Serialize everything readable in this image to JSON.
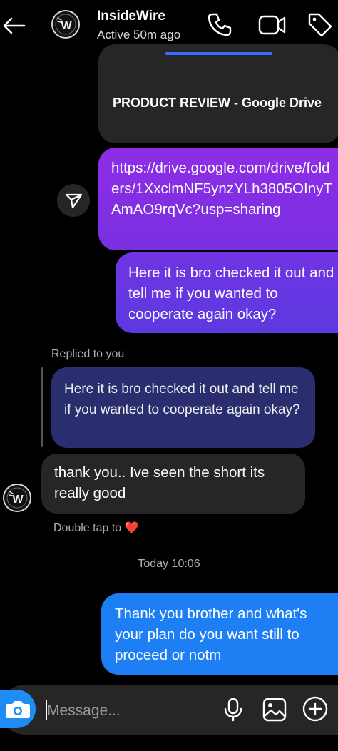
{
  "header": {
    "name": "InsideWire",
    "status": "Active 50m ago",
    "avatar_text": "W"
  },
  "shared_post": {
    "title": "PRODUCT REVIEW - Google Drive"
  },
  "messages": {
    "outgoing_link": "https://drive.google.com/drive/folders/1XxclmNF5ynzYLh3805OInyTAmAO9rqVc?usp=sharing",
    "outgoing_1": "Here it is bro checked it out and tell me if you wanted to cooperate again okay?",
    "replied_label": "Replied to you",
    "quoted_text": "Here it is bro checked it out and tell me if you wanted to cooperate again okay?",
    "incoming_1": "thank you.. Ive seen the short its really good",
    "double_tap": "Double tap to",
    "heart": "❤️",
    "timestamp": "Today 10:06",
    "outgoing_2": "Thank you brother and what's your plan do you want still to proceed or notm"
  },
  "composer": {
    "placeholder": "Message..."
  },
  "colors": {
    "link_bubble": "#8e2ee6",
    "outgoing_bubble": "#6a36e2",
    "blue_bubble": "#1e7ff5",
    "quoted_bubble": "#2b2e6e",
    "incoming_bubble": "#262626"
  },
  "icons": {
    "back": "arrow-left-icon",
    "call": "phone-icon",
    "video": "video-camera-icon",
    "tag": "tag-icon",
    "share": "send-icon",
    "camera": "camera-icon",
    "mic": "microphone-icon",
    "gallery": "image-icon",
    "plus": "plus-circle-icon"
  }
}
